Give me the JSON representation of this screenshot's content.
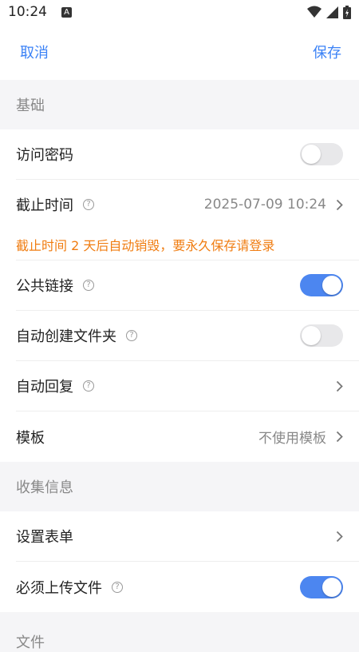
{
  "status_bar": {
    "time": "10:24",
    "notification_glyph": "A"
  },
  "nav": {
    "cancel": "取消",
    "save": "保存"
  },
  "sections": {
    "basic": "基础",
    "collect": "收集信息",
    "file_partial": "文件"
  },
  "basic_items": {
    "password": {
      "label": "访问密码",
      "enabled": false
    },
    "deadline": {
      "label": "截止时间",
      "value": "2025-07-09 10:24"
    },
    "deadline_warning": "截止时间 2 天后自动销毁，要永久保存请登录",
    "public_link": {
      "label": "公共链接",
      "enabled": true
    },
    "auto_folder": {
      "label": "自动创建文件夹",
      "enabled": false
    },
    "auto_reply": {
      "label": "自动回复"
    },
    "template": {
      "label": "模板",
      "value": "不使用模板"
    }
  },
  "collect_items": {
    "form": {
      "label": "设置表单"
    },
    "require_upload": {
      "label": "必须上传文件",
      "enabled": true
    }
  },
  "colors": {
    "accent": "#3b82f6",
    "toggle_on": "#4c86f0",
    "warning": "#f07d12"
  },
  "icons": {
    "help": "question-circle-icon",
    "chevron": "chevron-right-icon"
  }
}
